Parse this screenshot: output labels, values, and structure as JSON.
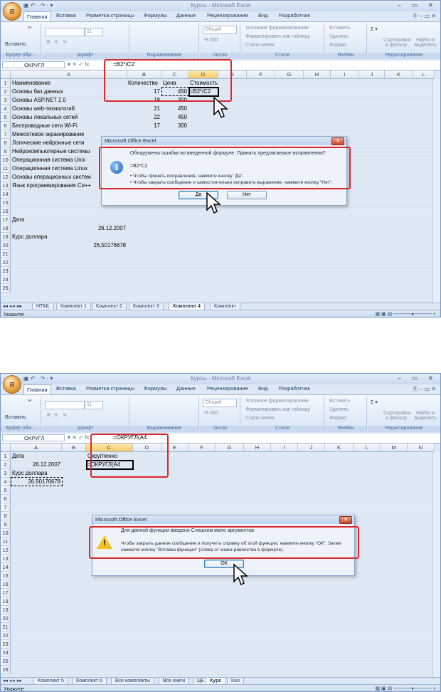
{
  "window1": {
    "title": "Курсы - Microsoft Excel",
    "orb_label": "⊞",
    "qat": "▣ ↶ · ↷ · ▾",
    "win_buttons": "– ▭ ✕",
    "tabs": [
      "Главная",
      "Вставка",
      "Разметка страницы",
      "Формулы",
      "Данные",
      "Рецензирование",
      "Вид",
      "Разработчик"
    ],
    "tab_right": "⓪ – ▭ ✕",
    "ribbon": {
      "paste": "Вставить",
      "clipboard": "Буфер обм...",
      "font_size": "11",
      "font_group": "Шрифт",
      "align_group": "Выравнивание",
      "number_format": "Общий",
      "number_group": "Число",
      "cond_format": "Условное форматирование",
      "format_table": "Форматировать как таблицу",
      "cell_styles": "Стили ячеек",
      "styles_group": "Стили",
      "insert": "Вставить",
      "delete": "Удалить",
      "format": "Формат",
      "cells_group": "Ячейки",
      "sort": "Сортировка и фильтр",
      "find": "Найти и выделить",
      "editing_group": "Редактирование",
      "bold": "Ж",
      "italic": "К",
      "underline": "Ч",
      "percent": "% 000"
    },
    "namebox": "ОКРУГЛ",
    "fx_icons": "▾ ✕ ✓ fx",
    "formula": "=B2*/C2",
    "columns": [
      "A",
      "B",
      "C",
      "D",
      "E",
      "F",
      "G",
      "H",
      "I",
      "J",
      "K",
      "L"
    ],
    "rows": [
      "1",
      "2",
      "3",
      "4",
      "5",
      "6",
      "7",
      "8",
      "9",
      "10",
      "11",
      "12",
      "13",
      "14",
      "15",
      "16",
      "17",
      "18",
      "19",
      "20",
      "21",
      "22",
      "23",
      "24",
      "25"
    ],
    "cells": {
      "a1": "Наименование",
      "b1": "Количество",
      "c1": "Цена",
      "d1": "Стоимость",
      "a2": "Основы баз данных",
      "b2": "17",
      "c2": "450",
      "d2": "=B2*/C2",
      "a3": "Основы ASP.NET 2.0",
      "b3": "18",
      "c3": "300",
      "a4": "Основы web-технологий",
      "b4": "21",
      "c4": "450",
      "a5": "Основы локальных сетей",
      "b5": "22",
      "c5": "450",
      "a6": "Беспроводные сети Wi-Fi",
      "b6": "17",
      "c6": "300",
      "a7": "Межсетевое экранирование",
      "a8": "Логические нейронные сети",
      "a9": "Нейрокомпьютерные системы",
      "a10": "Операционная система Unix",
      "a11": "Операционная система Linux",
      "a12": "Основы операционных систем",
      "a13": "Язык программирования Си++",
      "a17": "Дата",
      "a18": "26.12.2007",
      "a19": "Курс доллара",
      "a20": "26,50176678"
    },
    "sheets": [
      "HTML",
      "Комплект 1",
      "Комплект 2",
      "Комплект 3",
      "Комплект 4",
      "Комплект"
    ],
    "active_sheet": "Комплект 4",
    "status": "Укажите",
    "dialog": {
      "title": "Microsoft Office Excel",
      "line1": "Обнаружены ошибки во введенной формуле. Принять предлагаемые исправления?",
      "line2": "=B2*C2",
      "line3": "• Чтобы принять исправления, нажмите кнопку \"Да\".",
      "line4": "• Чтобы закрыть сообщение и самостоятельно исправить выражение, нажмите кнопку \"Нет\".",
      "yes": "Да",
      "no": "Нет",
      "close": "✕"
    }
  },
  "window2": {
    "title": "Курсы - Microsoft Excel",
    "orb_label": "⊞",
    "qat": "▣ ↶ · ↷ · ▾",
    "win_buttons": "– ▭ ✕",
    "tabs": [
      "Главная",
      "Вставка",
      "Разметка страницы",
      "Формулы",
      "Данные",
      "Рецензирование",
      "Вид",
      "Разработчик"
    ],
    "tab_right": "⓪ – ▭ ✕",
    "namebox": "ОКРУГЛ",
    "fx_icons": "▾ ✕ ✓ fx",
    "formula": "=ОКРУГЛ(A4",
    "columns": [
      "A",
      "B",
      "C",
      "D",
      "E",
      "F",
      "G",
      "H",
      "I",
      "J",
      "K",
      "L",
      "M",
      "N"
    ],
    "rows": [
      "1",
      "2",
      "3",
      "4",
      "5",
      "6",
      "7",
      "8",
      "9",
      "10",
      "11",
      "12",
      "13",
      "14",
      "15",
      "16",
      "17",
      "18",
      "19",
      "20",
      "21",
      "22",
      "23",
      "24",
      "25",
      "26"
    ],
    "cells": {
      "a1": "Дата",
      "c1": "Округленно",
      "a2": "26.12.2007",
      "c2": "=ОКРУГЛ(A4",
      "a3": "Курс доллара",
      "a4": "26,50176678"
    },
    "sheets": [
      "Комплект 5",
      "Комплект 6",
      "Все комплекты",
      "Все книги",
      "ЦБ",
      "Курс",
      "Кол"
    ],
    "active_sheet": "Курс",
    "status": "Укажите",
    "dialog": {
      "title": "Microsoft Office Excel",
      "line1": "Для данной функции введено Слишком мало аргументов.",
      "line2": "Чтобы закрыть данное сообщение и получить справку об этой функции, нажмите кнопку \"ОК\". Затем",
      "line3": "нажмите кнопку \"Вставка функции\" (слева от знака равенства в формуле).",
      "ok": "ОК",
      "close": "✕",
      "warn": "!"
    }
  },
  "colors": {
    "accent": "#d8292e",
    "ribbon": "#dfe9f5",
    "selected_header": "#f5c96b"
  }
}
